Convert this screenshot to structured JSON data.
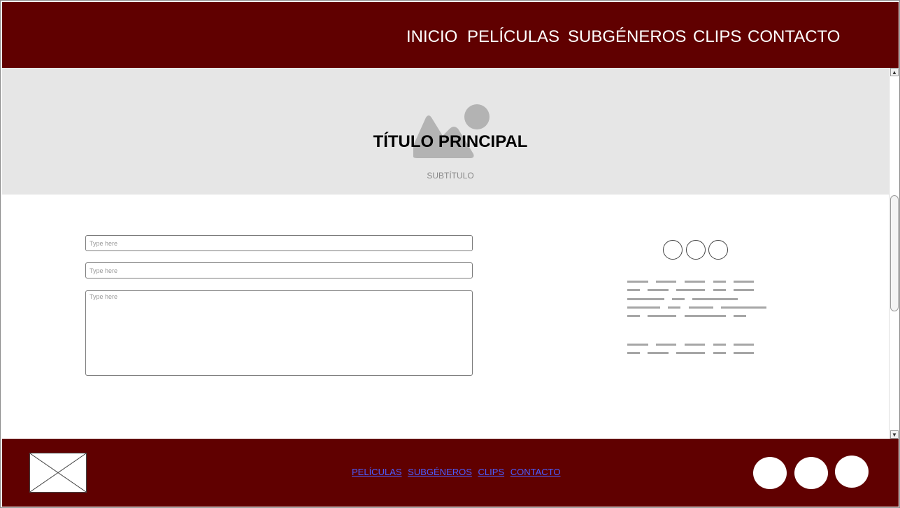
{
  "header": {
    "nav": [
      "INICIO",
      "PELÍCULAS",
      "SUBGÉNEROS",
      "CLIPS",
      "CONTACTO"
    ]
  },
  "hero": {
    "title": "TÍTULO PRINCIPAL",
    "subtitle": "SUBTÍTULO",
    "image_icon": "image-placeholder-icon"
  },
  "form": {
    "fields": [
      {
        "placeholder": "Type here"
      },
      {
        "placeholder": "Type here"
      },
      {
        "placeholder": "Type here"
      }
    ]
  },
  "footer": {
    "links": [
      "PELÍCULAS",
      "SUBGÉNEROS",
      "CLIPS",
      "CONTACTO"
    ],
    "logo_icon": "image-placeholder-icon"
  },
  "colors": {
    "brand": "#600000",
    "hero_bg": "#e6e6e6",
    "link": "#4a5cff"
  }
}
